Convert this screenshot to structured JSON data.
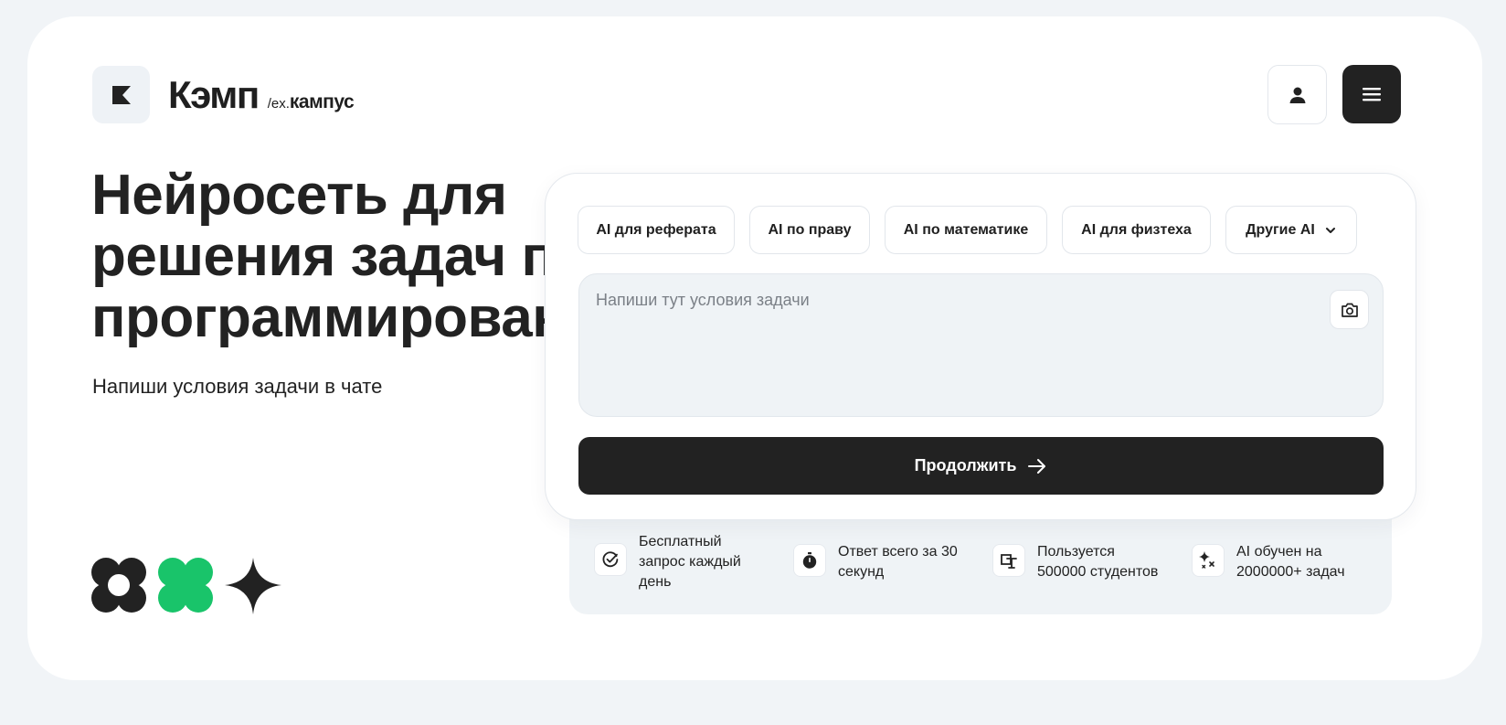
{
  "brand": {
    "name": "Кэмп",
    "sub_prefix": "/ex.",
    "sub_name": "кампус"
  },
  "hero": {
    "title": "Нейросеть для\nрешения задач по\nпрограммированию",
    "subtitle": "Напиши условия задачи в чате"
  },
  "chips": [
    {
      "label": "AI для реферата"
    },
    {
      "label": "AI по праву"
    },
    {
      "label": "AI по математике"
    },
    {
      "label": "AI для физтеха"
    },
    {
      "label": "Другие AI"
    }
  ],
  "task_input": {
    "placeholder": "Напиши тут условия задачи",
    "value": ""
  },
  "continue_label": "Продолжить",
  "stats": [
    {
      "icon": "check-circle-icon",
      "text": "Бесплатный\nзапрос каждый\nдень"
    },
    {
      "icon": "stopwatch-icon",
      "text": "Ответ всего за 30\nсекунд"
    },
    {
      "icon": "students-icon",
      "text": "Пользуется\n500000 студентов"
    },
    {
      "icon": "sparkles-icon",
      "text": "AI обучен на\n2000000+ задач"
    }
  ],
  "colors": {
    "dark": "#222222",
    "accent_green": "#19c46a",
    "page_bg": "#f1f4f7",
    "input_bg": "#eff3f6"
  }
}
